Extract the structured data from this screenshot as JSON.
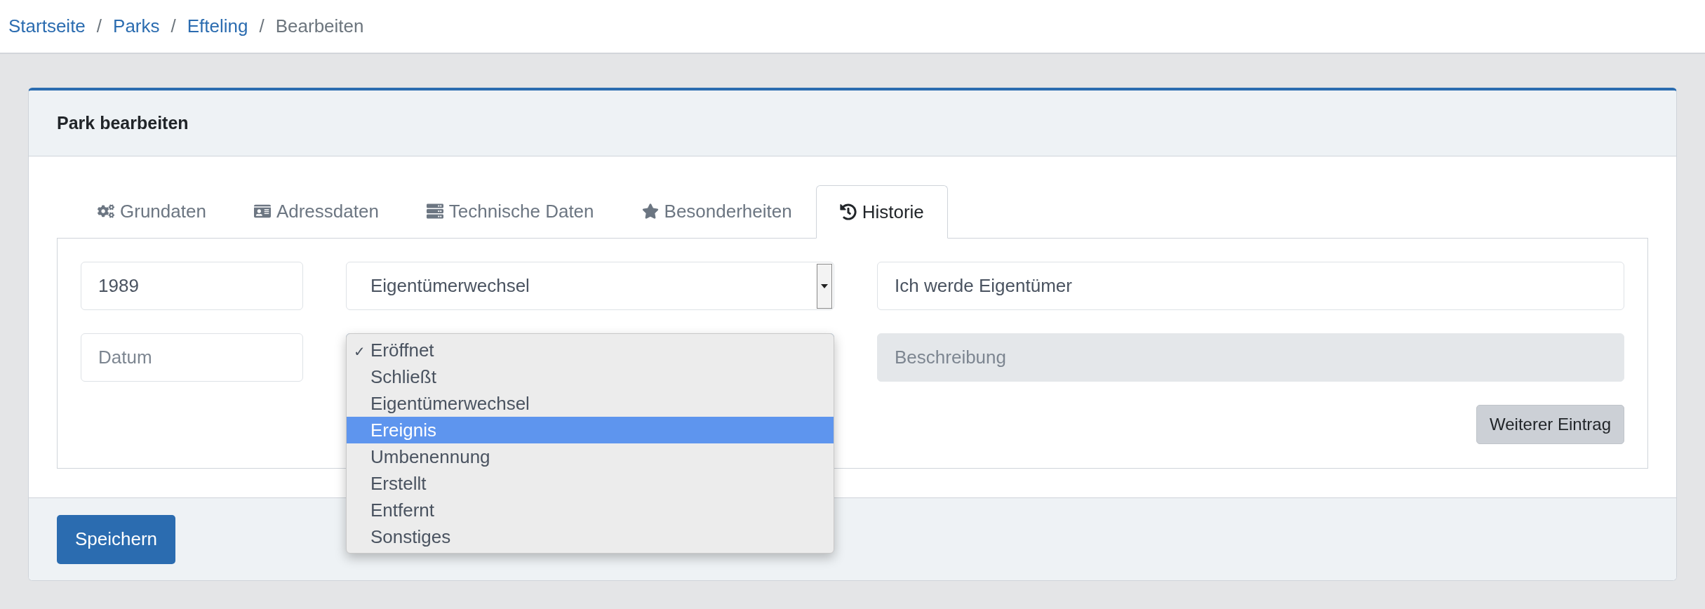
{
  "breadcrumb": [
    {
      "kind": "link",
      "label": "Startseite"
    },
    {
      "kind": "separator",
      "label": "/"
    },
    {
      "kind": "link",
      "label": "Parks"
    },
    {
      "kind": "separator",
      "label": "/"
    },
    {
      "kind": "link",
      "label": "Efteling"
    },
    {
      "kind": "separator",
      "label": "/"
    },
    {
      "kind": "current",
      "label": "Bearbeiten"
    }
  ],
  "card": {
    "title": "Park bearbeiten"
  },
  "tabs": [
    {
      "label": "Grundaten",
      "selected": false
    },
    {
      "label": "Adressdaten",
      "selected": false
    },
    {
      "label": "Technische Daten",
      "selected": false
    },
    {
      "label": "Besonderheiten",
      "selected": false
    },
    {
      "label": "Historie",
      "selected": true
    }
  ],
  "entries": [
    {
      "date": {
        "value": "1989"
      },
      "type": {
        "value": "Eigentümerwechsel",
        "open": false
      },
      "description": {
        "value": "Ich werde Eigentümer",
        "disabled": false
      }
    },
    {
      "date": {
        "placeholder": "Datum"
      },
      "type": {
        "open": true
      },
      "description": {
        "placeholder": "Beschreibung",
        "disabled": true
      }
    }
  ],
  "check_mark": "✓",
  "dropdown_options": [
    {
      "label": "Eröffnet",
      "selected": true,
      "highlighted": false
    },
    {
      "label": "Schließt",
      "selected": false,
      "highlighted": false
    },
    {
      "label": "Eigentümerwechsel",
      "selected": false,
      "highlighted": false
    },
    {
      "label": "Ereignis",
      "selected": false,
      "highlighted": true
    },
    {
      "label": "Umbenennung",
      "selected": false,
      "highlighted": false
    },
    {
      "label": "Erstellt",
      "selected": false,
      "highlighted": false
    },
    {
      "label": "Entfernt",
      "selected": false,
      "highlighted": false
    },
    {
      "label": "Sonstiges",
      "selected": false,
      "highlighted": false
    }
  ],
  "add_button": "Weiterer Eintrag",
  "save_button": "Speichern"
}
